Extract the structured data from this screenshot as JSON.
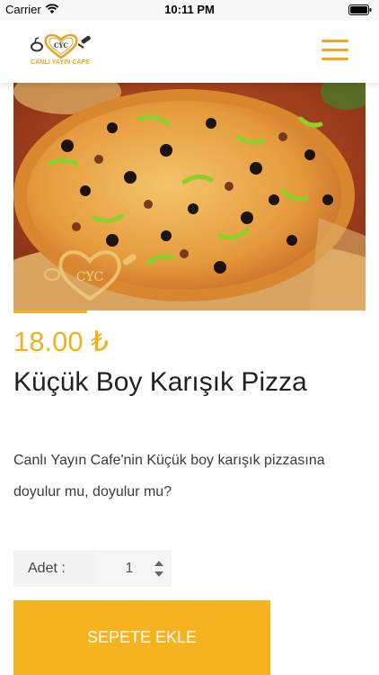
{
  "status_bar": {
    "carrier": "Carrier",
    "time": "10:11 PM"
  },
  "header": {
    "logo_text": "CANLI YAYIN CAFE",
    "logo_monogram": "CYC",
    "menu_icon": "hamburger-menu-icon"
  },
  "product": {
    "image_watermark": "CYC",
    "price": "18.00 ₺",
    "title": "Küçük Boy Karışık Pizza",
    "description": "Canlı Yayın Cafe'nin Küçük boy karışık pizzasına doyulur mu, doyulur mu?"
  },
  "quantity": {
    "label": "Adet :",
    "value": "1"
  },
  "cart": {
    "add_label": "SEPETE EKLE"
  },
  "colors": {
    "accent": "#f5b41f",
    "price": "#f2b01f"
  }
}
